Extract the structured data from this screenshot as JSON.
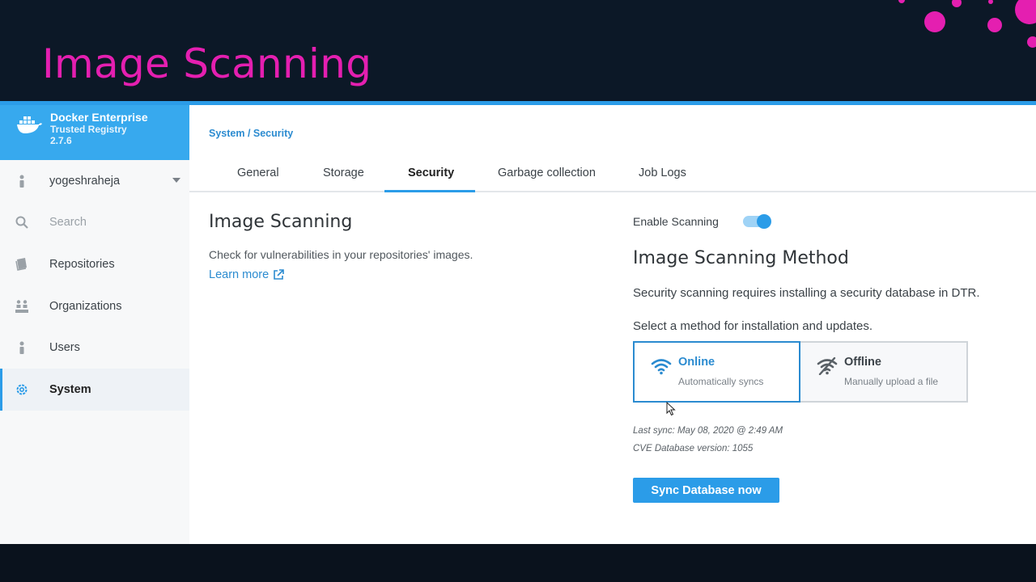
{
  "slide": {
    "title": "Image Scanning"
  },
  "brand": {
    "name": "Docker Enterprise",
    "product": "Trusted Registry",
    "version": "2.7.6"
  },
  "sidebar": {
    "user": "yogeshraheja",
    "search_placeholder": "Search",
    "items": [
      {
        "label": "Repositories",
        "icon": "book-icon"
      },
      {
        "label": "Organizations",
        "icon": "organizations-icon"
      },
      {
        "label": "Users",
        "icon": "user-icon"
      },
      {
        "label": "System",
        "icon": "gear-icon",
        "active": true
      }
    ]
  },
  "breadcrumb": "System / Security",
  "tabs": [
    "General",
    "Storage",
    "Security",
    "Garbage collection",
    "Job Logs"
  ],
  "active_tab": "Security",
  "left": {
    "heading": "Image Scanning",
    "description": "Check for vulnerabilities in your repositories' images.",
    "learn_more": "Learn more"
  },
  "right": {
    "enable_label": "Enable Scanning",
    "enabled": true,
    "heading": "Image Scanning Method",
    "requirement": "Security scanning requires installing a security database in DTR.",
    "select_text": "Select a method for installation and updates.",
    "methods": [
      {
        "title": "Online",
        "subtitle": "Automatically syncs",
        "icon": "wifi-icon",
        "selected": true
      },
      {
        "title": "Offline",
        "subtitle": "Manually upload a file",
        "icon": "wifi-off-icon",
        "selected": false
      }
    ],
    "last_sync": "Last sync: May 08, 2020 @ 2:49 AM",
    "cve_version": "CVE Database version: 1055",
    "sync_button": "Sync Database now"
  },
  "colors": {
    "accent": "#2b9ce8",
    "title_pink": "#e41fb0",
    "background": "#0c1827"
  }
}
